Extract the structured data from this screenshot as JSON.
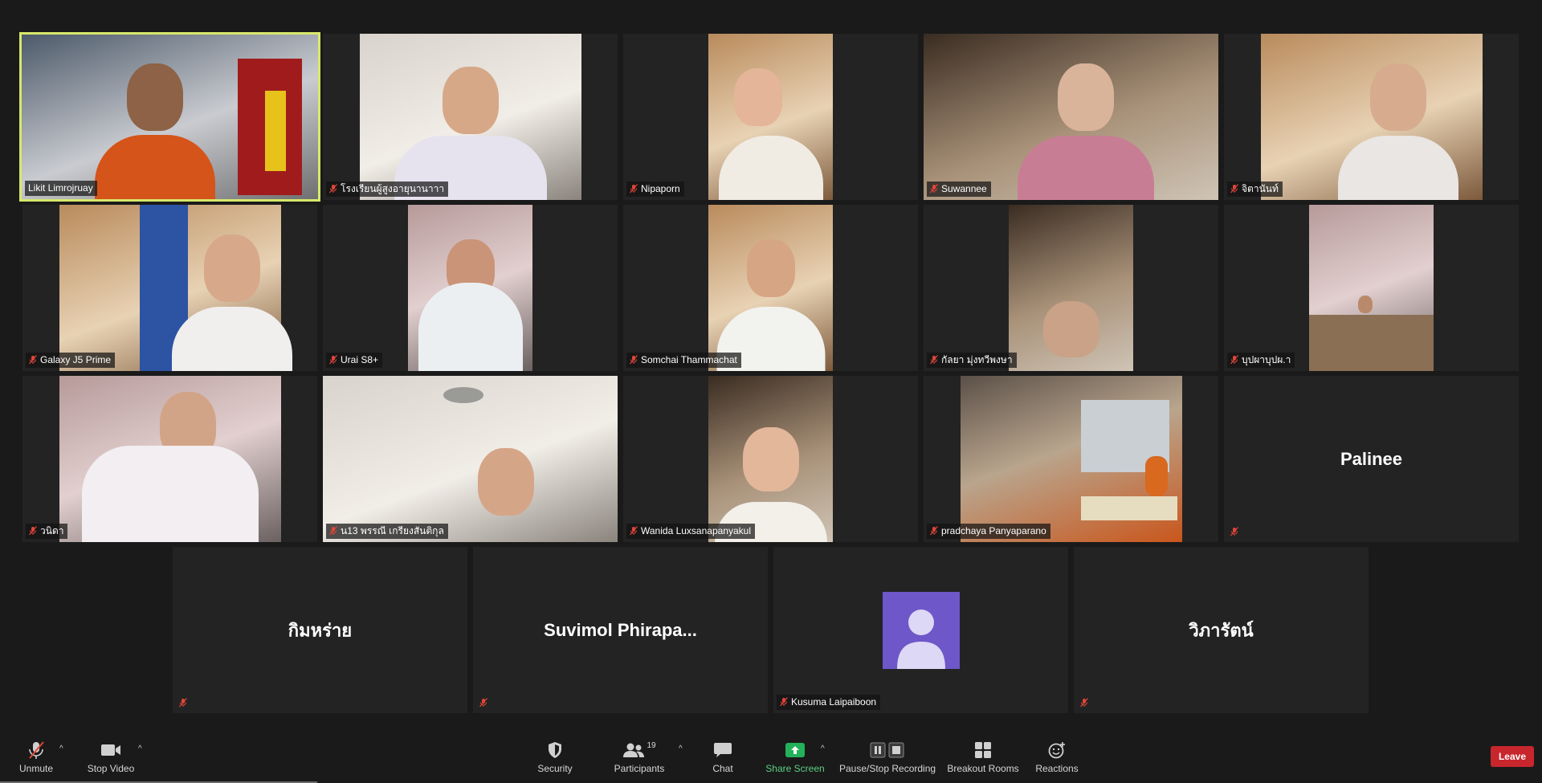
{
  "participants": [
    {
      "name": "Likit Limrojruay",
      "muted": false,
      "active": true
    },
    {
      "name": "โรงเรียนผู้สูงอายุนานาาา",
      "muted": true
    },
    {
      "name": "Nipaporn",
      "muted": true
    },
    {
      "name": "Suwannee",
      "muted": true
    },
    {
      "name": "จิตานันท์",
      "muted": true
    },
    {
      "name": "Galaxy J5 Prime",
      "muted": true
    },
    {
      "name": "Urai S8+",
      "muted": true
    },
    {
      "name": "Somchai Thammachat",
      "muted": true
    },
    {
      "name": "กัลยา มุ่งทวีพงษา",
      "muted": true
    },
    {
      "name": "บุปผาบุปผ.า",
      "muted": true
    },
    {
      "name": "วนิดา",
      "muted": true
    },
    {
      "name": "น13 พรรณี เกรียงสันติกุล",
      "muted": true
    },
    {
      "name": "Wanida Luxsanapanyakul",
      "muted": true
    },
    {
      "name": "pradchaya Panyaparano",
      "muted": true
    },
    {
      "name": "Palinee",
      "muted": true,
      "video_off": true
    },
    {
      "name": "กิมหร่าย",
      "muted": true,
      "video_off": true
    },
    {
      "name": "Suvimol  Phirapa...",
      "muted": true,
      "video_off": true
    },
    {
      "name": "Kusuma Laipaiboon",
      "muted": true,
      "video_off": true,
      "avatar": true
    },
    {
      "name": "วิภารัตน์",
      "muted": true,
      "video_off": true
    }
  ],
  "toolbar": {
    "unmute": "Unmute",
    "stop_video": "Stop Video",
    "security": "Security",
    "participants": "Participants",
    "participants_count": "19",
    "chat": "Chat",
    "share_screen": "Share Screen",
    "pause_stop_recording": "Pause/Stop Recording",
    "breakout_rooms": "Breakout Rooms",
    "reactions": "Reactions",
    "leave": "Leave"
  },
  "colors": {
    "active_speaker_border": "#d7e86a",
    "muted_icon": "#e0453a",
    "share_green": "#23b15a",
    "leave_red": "#c8262d",
    "avatar_purple": "#6e57c9"
  }
}
